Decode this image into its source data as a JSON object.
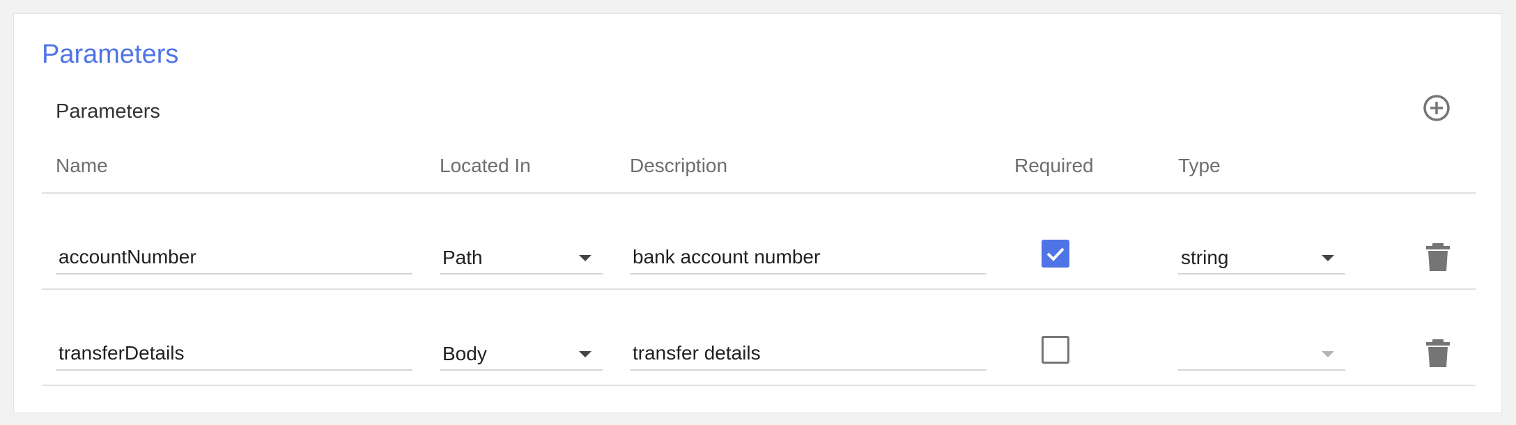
{
  "section": {
    "title": "Parameters"
  },
  "table": {
    "title": "Parameters",
    "add_icon": "add-circle-icon",
    "columns": {
      "name": "Name",
      "located_in": "Located In",
      "description": "Description",
      "required": "Required",
      "type": "Type"
    },
    "rows": [
      {
        "name": "accountNumber",
        "located_in": "Path",
        "description": "bank account number",
        "required": true,
        "type": "string"
      },
      {
        "name": "transferDetails",
        "located_in": "Body",
        "description": "transfer details",
        "required": false,
        "type": ""
      }
    ]
  },
  "colors": {
    "accent": "#4f74e8",
    "icon_gray": "#757575"
  }
}
